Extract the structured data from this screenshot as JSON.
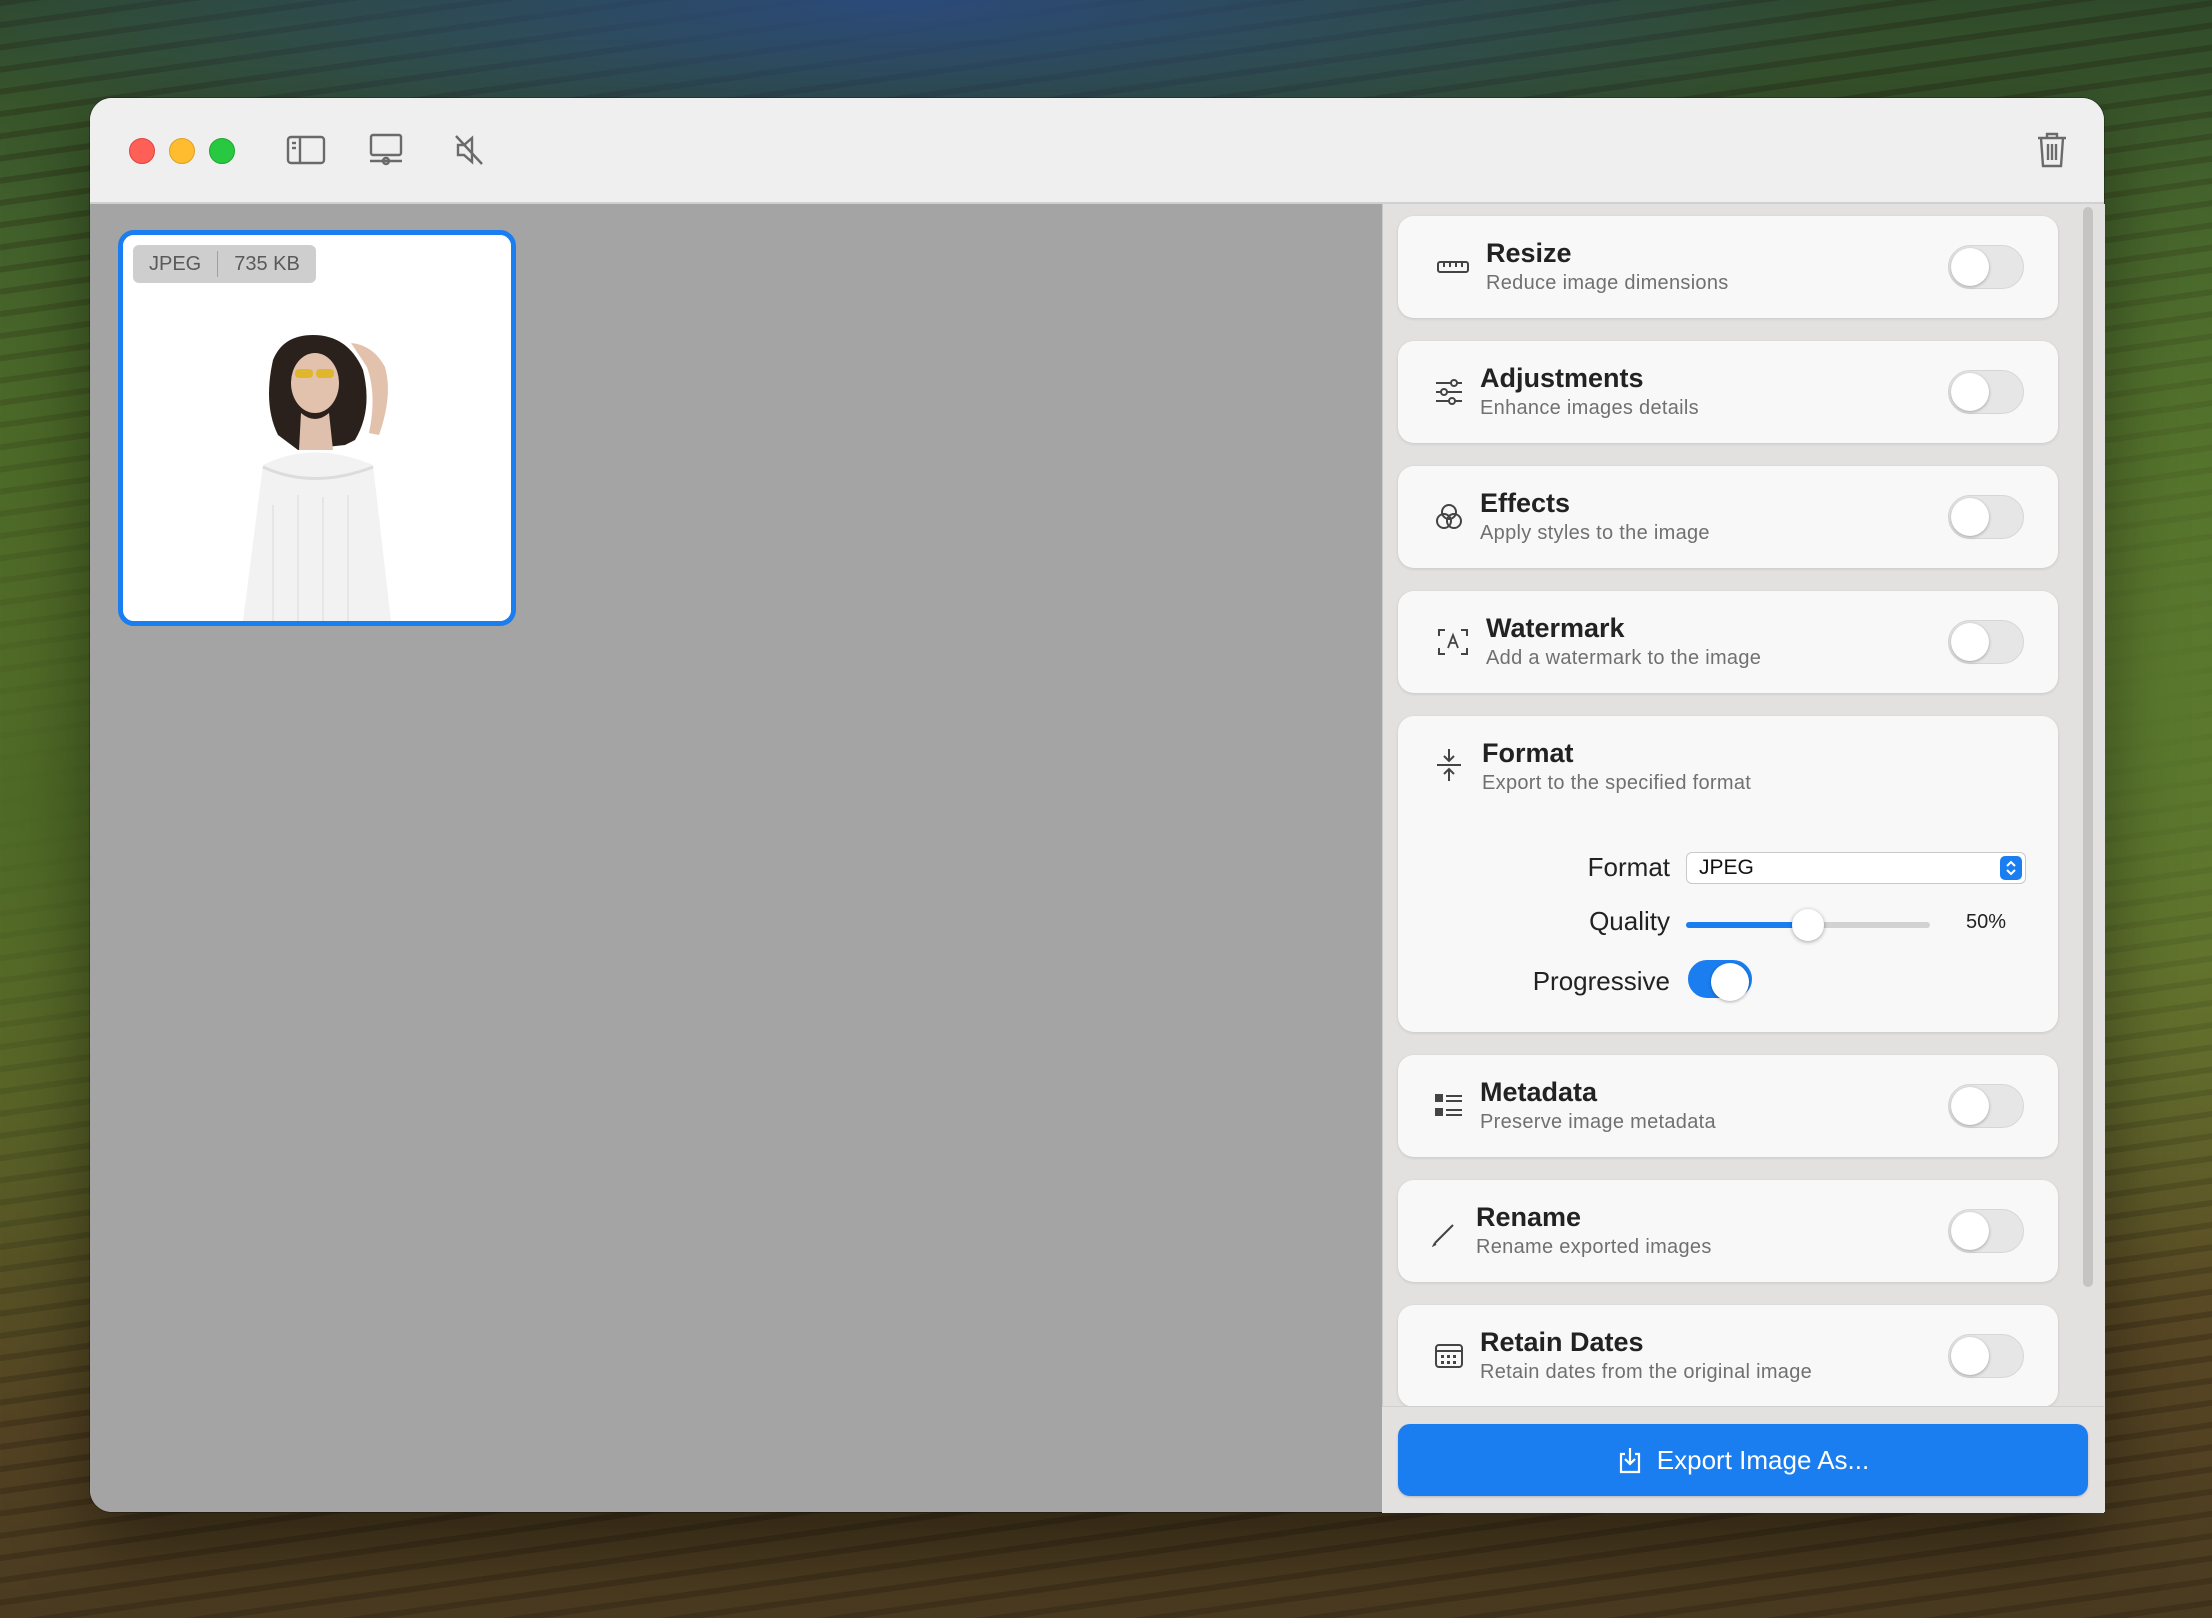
{
  "toolbar": {
    "sidebar_icon": "sidebar-icon",
    "display_icon": "display-icon",
    "mute_icon": "speaker-muted-icon",
    "trash_icon": "trash-icon"
  },
  "thumbnail": {
    "format": "JPEG",
    "size": "735 KB"
  },
  "panel": {
    "resize": {
      "title": "Resize",
      "subtitle": "Reduce image dimensions",
      "icon": "ruler-icon",
      "enabled": false
    },
    "adjustments": {
      "title": "Adjustments",
      "subtitle": "Enhance images details",
      "icon": "sliders-icon",
      "enabled": false
    },
    "effects": {
      "title": "Effects",
      "subtitle": "Apply styles to the image",
      "icon": "circles-icon",
      "enabled": false
    },
    "watermark": {
      "title": "Watermark",
      "subtitle": "Add a watermark to the image",
      "icon": "watermark-icon",
      "enabled": false
    },
    "format": {
      "title": "Format",
      "subtitle": "Export to the specified format",
      "icon": "compress-icon",
      "format_label": "Format",
      "format_value": "JPEG",
      "quality_label": "Quality",
      "quality_value": "50%",
      "quality_fraction": 0.5,
      "progressive_label": "Progressive",
      "progressive_enabled": true
    },
    "metadata": {
      "title": "Metadata",
      "subtitle": "Preserve image metadata",
      "icon": "list-icon",
      "enabled": false
    },
    "rename": {
      "title": "Rename",
      "subtitle": "Rename exported images",
      "icon": "pencil-icon",
      "enabled": false
    },
    "retain_dates": {
      "title": "Retain Dates",
      "subtitle": "Retain dates from the original image",
      "icon": "calendar-icon",
      "enabled": false
    }
  },
  "export": {
    "label": "Export Image As...",
    "icon": "export-icon"
  },
  "colors": {
    "accent": "#1a7df0",
    "close": "#fe5f57",
    "minimize": "#febc2e",
    "maximize": "#28c840"
  }
}
